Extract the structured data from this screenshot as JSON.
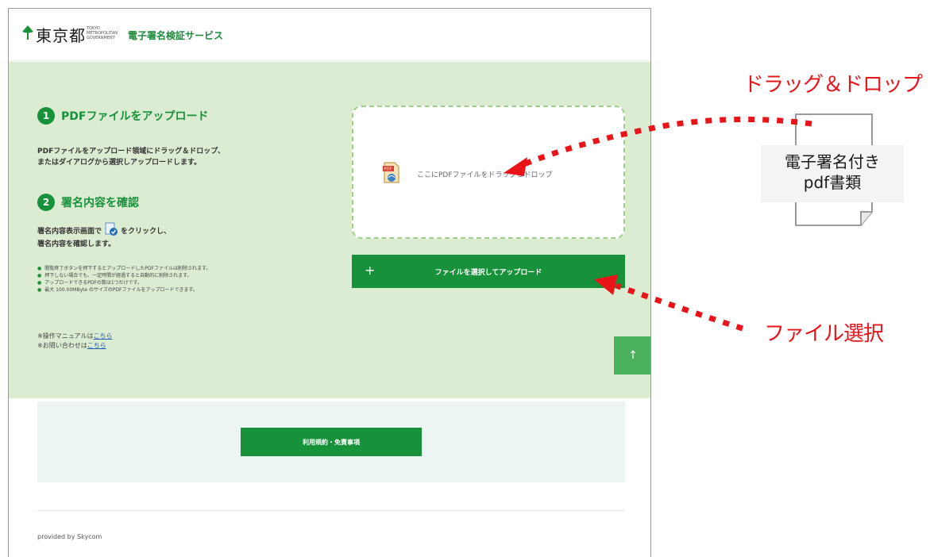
{
  "header": {
    "logo_text": "東京都",
    "logo_sub": "TOKYO METROPOLITAN GOVERNMENT",
    "service_name": "電子署名検証サービス"
  },
  "steps": [
    {
      "number": "1",
      "title": "PDFファイルをアップロード",
      "description": [
        "PDFファイルをアップロード領域にドラッグ＆ドロップ、",
        "またはダイアログから選択しアップロードします。"
      ]
    },
    {
      "number": "2",
      "title": "署名内容を確認",
      "description_prefix": "署名内容表示画面で",
      "description_suffix": "をクリックし、",
      "description_line2": "署名内容を確認します。"
    }
  ],
  "notes": [
    "閲覧終了ボタンを押下するとアップロードしたPDFファイルは削除されます。",
    "押下しない場合でも、一定時間が経過すると自動的に削除されます。",
    "アップロードできるPDFの数は1つだけです。",
    "最大 100.00MByte のサイズのPDFファイルをアップロードできます。"
  ],
  "links": {
    "manual_prefix": "※操作マニュアルは",
    "manual_link": "こちら",
    "contact_prefix": "※お問い合わせは",
    "contact_link": "こちら"
  },
  "dropzone": {
    "text": "ここにPDFファイルをドラッグ＆ドロップ"
  },
  "upload_button": {
    "plus": "+",
    "label": "ファイルを選択してアップロード"
  },
  "scroll_top": "↑",
  "terms_button": "利用規約・免責事項",
  "footer": "provided by Skycom",
  "annotations": {
    "drag_drop": "ドラッグ＆ドロップ",
    "file_select": "ファイル選択",
    "document_line1": "電子署名付き",
    "document_line2": "pdf書類"
  },
  "colors": {
    "brand_green": "#17913a",
    "panel_green": "#dcecd3",
    "annotation_red": "#e8141a"
  }
}
